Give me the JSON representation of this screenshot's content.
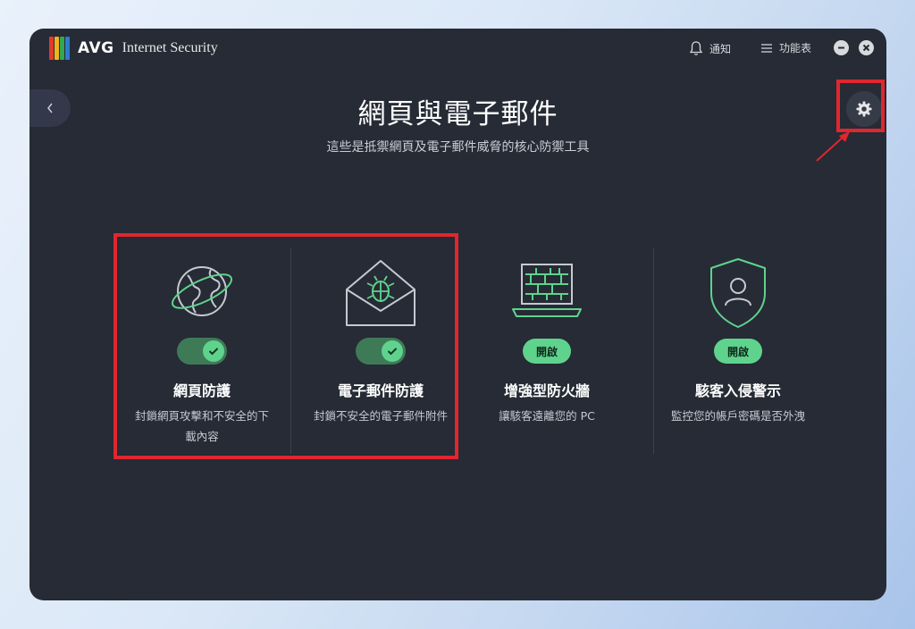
{
  "app": {
    "brand": "AVG",
    "product": "Internet Security"
  },
  "titlebar": {
    "notify_label": "通知",
    "menu_label": "功能表"
  },
  "page": {
    "title": "網頁與電子郵件",
    "subtitle": "這些是抵禦網頁及電子郵件威脅的核心防禦工具"
  },
  "features": [
    {
      "title": "網頁防護",
      "desc": "封鎖網頁攻擊和不安全的下載內容",
      "state": "on"
    },
    {
      "title": "電子郵件防護",
      "desc": "封鎖不安全的電子郵件附件",
      "state": "on"
    },
    {
      "title": "增強型防火牆",
      "desc": "讓駭客遠離您的 PC",
      "state": "off",
      "button_label": "開啟"
    },
    {
      "title": "駭客入侵警示",
      "desc": "監控您的帳戶密碼是否外洩",
      "state": "off",
      "button_label": "開啟"
    }
  ],
  "colors": {
    "window_bg": "#262b35",
    "accent_green": "#5fd38d",
    "toggle_track": "#3f7a57",
    "highlight_red": "#e0262e"
  },
  "icons": {
    "logo": "avg-logo-icon",
    "notify": "bell-icon",
    "menu": "hamburger-icon",
    "minimize": "minimize-icon",
    "close": "close-icon",
    "back": "chevron-left-icon",
    "settings": "gear-icon",
    "web": "globe-icon",
    "email": "envelope-bug-icon",
    "firewall": "firewall-laptop-icon",
    "hack_alert": "shield-user-icon"
  }
}
